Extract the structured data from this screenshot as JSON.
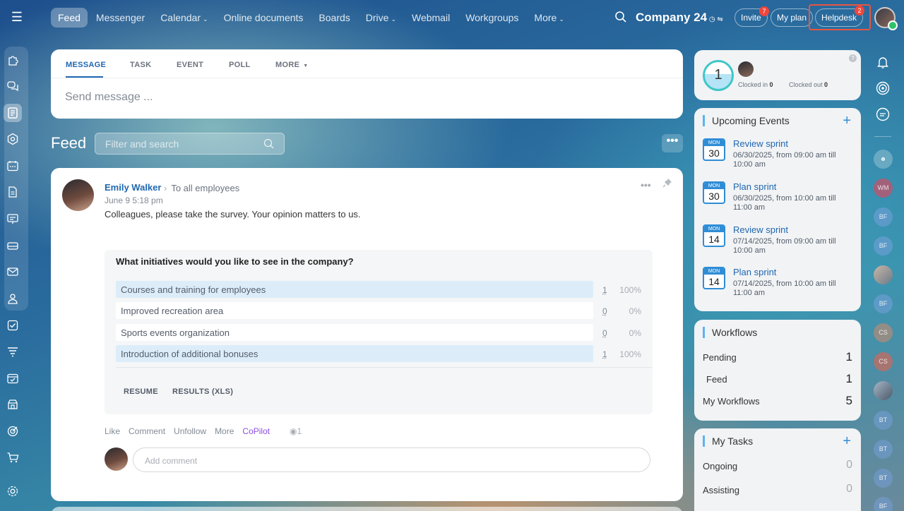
{
  "topbar": {
    "nav": [
      {
        "label": "Feed",
        "active": true,
        "dropdown": false
      },
      {
        "label": "Messenger",
        "active": false,
        "dropdown": false
      },
      {
        "label": "Calendar",
        "active": false,
        "dropdown": true
      },
      {
        "label": "Online documents",
        "active": false,
        "dropdown": false
      },
      {
        "label": "Boards",
        "active": false,
        "dropdown": false
      },
      {
        "label": "Drive",
        "active": false,
        "dropdown": true
      },
      {
        "label": "Webmail",
        "active": false,
        "dropdown": false
      },
      {
        "label": "Workgroups",
        "active": false,
        "dropdown": false
      },
      {
        "label": "More",
        "active": false,
        "dropdown": true
      }
    ],
    "company": "Company 24",
    "invite_label": "Invite",
    "invite_badge": "7",
    "myplan_label": "My plan",
    "helpdesk_label": "Helpdesk",
    "helpdesk_badge": "2"
  },
  "composer": {
    "tabs": [
      "MESSAGE",
      "TASK",
      "EVENT",
      "POLL",
      "MORE"
    ],
    "placeholder": "Send message ..."
  },
  "feed": {
    "title": "Feed",
    "filter_placeholder": "Filter and search"
  },
  "post": {
    "author": "Emily Walker",
    "audience": "To all employees",
    "date": "June 9 5:18 pm",
    "text": "Colleagues, please take the survey. Your opinion matters to us.",
    "poll": {
      "question": "What initiatives would you like to see in the company?",
      "options": [
        {
          "label": "Courses and training for employees",
          "count": "1",
          "percent": "100%",
          "fill": 1.0
        },
        {
          "label": "Improved recreation area",
          "count": "0",
          "percent": "0%",
          "fill": 0
        },
        {
          "label": "Sports events organization",
          "count": "0",
          "percent": "0%",
          "fill": 0
        },
        {
          "label": "Introduction of additional bonuses",
          "count": "1",
          "percent": "100%",
          "fill": 1.0
        }
      ],
      "resume_label": "RESUME",
      "results_label": "RESULTS (XLS)"
    },
    "actions": {
      "like": "Like",
      "comment": "Comment",
      "unfollow": "Unfollow",
      "more": "More",
      "copilot": "CoPilot",
      "views": "1"
    },
    "comment_placeholder": "Add comment"
  },
  "timecard": {
    "counter": "1",
    "clocked_in_label": "Clocked in",
    "clocked_in_value": "0",
    "clocked_out_label": "Clocked out",
    "clocked_out_value": "0"
  },
  "events": {
    "title": "Upcoming Events",
    "items": [
      {
        "month": "MON",
        "day": "30",
        "title": "Review sprint",
        "date": "06/30/2025, from 09:00 am till 10:00 am"
      },
      {
        "month": "MON",
        "day": "30",
        "title": "Plan sprint",
        "date": "06/30/2025, from 10:00 am till 11:00 am"
      },
      {
        "month": "MON",
        "day": "14",
        "title": "Review sprint",
        "date": "07/14/2025, from 09:00 am till 10:00 am"
      },
      {
        "month": "MON",
        "day": "14",
        "title": "Plan sprint",
        "date": "07/14/2025, from 10:00 am till 11:00 am"
      }
    ]
  },
  "workflows": {
    "title": "Workflows",
    "items": [
      {
        "label": "Pending",
        "value": "1"
      },
      {
        "label": "Feed",
        "value": "1"
      },
      {
        "label": "My Workflows",
        "value": "5"
      }
    ]
  },
  "tasks": {
    "title": "My Tasks",
    "items": [
      {
        "label": "Ongoing",
        "value": "0"
      },
      {
        "label": "Assisting",
        "value": "0"
      }
    ]
  },
  "rightbar": {
    "avatars": [
      "WM",
      "BF",
      "BF",
      "",
      "BF",
      "CS",
      "CS",
      "",
      "BT",
      "BT",
      "BT",
      "BF"
    ]
  }
}
